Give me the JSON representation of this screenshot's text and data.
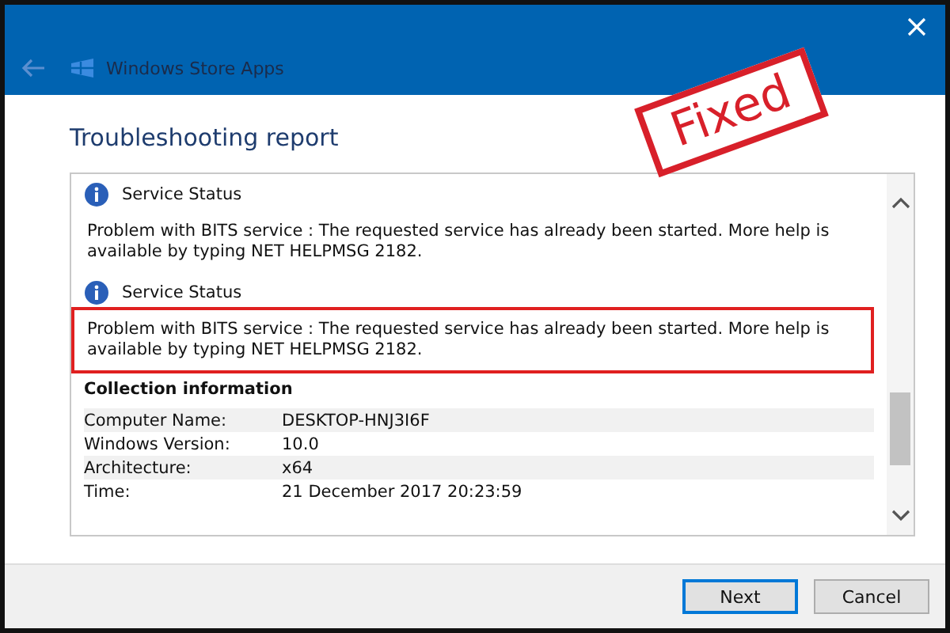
{
  "window": {
    "title": "Windows Store Apps"
  },
  "stamp": {
    "text": "Fixed"
  },
  "heading": "Troubleshooting report",
  "messages": [
    {
      "title": "Service Status",
      "text": "Problem with BITS service : The requested service has already been started. More help is available by typing NET HELPMSG 2182.",
      "highlighted": false
    },
    {
      "title": "Service Status",
      "text": "Problem with BITS service : The requested service has already been started. More help is available by typing NET HELPMSG 2182.",
      "highlighted": true
    }
  ],
  "collection": {
    "title": "Collection information",
    "rows": [
      {
        "label": "Computer Name:",
        "value": "DESKTOP-HNJ3I6F"
      },
      {
        "label": "Windows Version:",
        "value": "10.0"
      },
      {
        "label": "Architecture:",
        "value": "x64"
      },
      {
        "label": "Time:",
        "value": "21 December 2017 20:23:59"
      }
    ]
  },
  "buttons": [
    {
      "label": "Next",
      "selected": true
    },
    {
      "label": "Cancel",
      "selected": false
    }
  ]
}
